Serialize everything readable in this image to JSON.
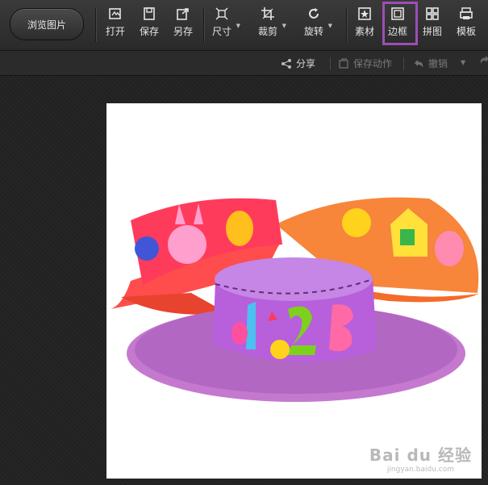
{
  "browse_button": "浏览图片",
  "tools": [
    {
      "label": "打开",
      "icon": "open-icon"
    },
    {
      "label": "保存",
      "icon": "save-icon"
    },
    {
      "label": "另存",
      "icon": "save-as-icon"
    },
    {
      "label": "尺寸",
      "icon": "resize-icon"
    },
    {
      "label": "裁剪",
      "icon": "crop-icon"
    },
    {
      "label": "旋转",
      "icon": "rotate-icon"
    },
    {
      "label": "素材",
      "icon": "sticker-icon"
    },
    {
      "label": "边框",
      "icon": "frame-icon"
    },
    {
      "label": "拼图",
      "icon": "collage-icon"
    },
    {
      "label": "模板",
      "icon": "template-icon"
    }
  ],
  "subbar": {
    "share": "分享",
    "save_action": "保存动作",
    "undo": "撤销"
  },
  "watermark": {
    "main": "Bai du 经验",
    "sub": "jingyan.baidu.com"
  },
  "colors": {
    "highlight": "#9c4fb4"
  }
}
